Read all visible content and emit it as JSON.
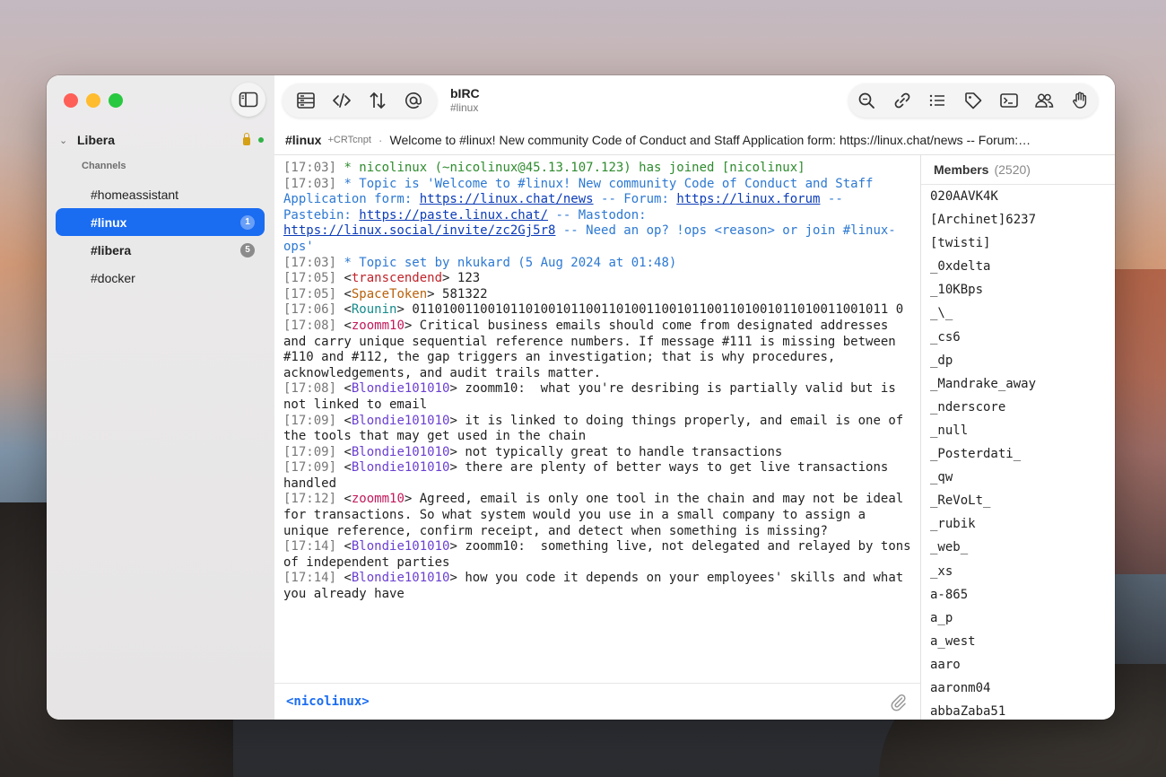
{
  "app": {
    "title": "bIRC",
    "channel": "#linux"
  },
  "sidebar": {
    "network": "Libera",
    "section_label": "Channels",
    "channels": [
      {
        "name": "#homeassistant",
        "badge": ""
      },
      {
        "name": "#linux",
        "badge": "1"
      },
      {
        "name": "#libera",
        "badge": "5"
      },
      {
        "name": "#docker",
        "badge": ""
      }
    ]
  },
  "topic_bar": {
    "channel": "#linux",
    "modes": "+CRTcnpt",
    "separator": "·",
    "text": "Welcome to #linux! New community Code of Conduct and Staff Application form: https://linux.chat/news -- Forum:…"
  },
  "messages": [
    {
      "ts": "[17:03]",
      "type": "join",
      "text": " * nicolinux (~nicolinux@45.13.107.123) has joined [nicolinux]"
    },
    {
      "ts": "[17:03]",
      "type": "topic",
      "pre": " * Topic is 'Welcome to #linux! New community Code of Conduct and Staff Application form: ",
      "link1": "https://linux.chat/news",
      "mid1": " -- Forum: ",
      "link2": "https://linux.forum",
      "mid2": " -- Pastebin: ",
      "link3": "https://paste.linux.chat/",
      "mid3": " -- Mastodon: ",
      "link4": "https://linux.social/invite/zc2Gj5r8",
      "post": " -- Need an op? !ops <reason> or join #linux-ops'"
    },
    {
      "ts": "[17:03]",
      "type": "topic",
      "text": " * Topic set by nkukard (5 Aug 2024 at 01:48)"
    },
    {
      "ts": "[17:05]",
      "type": "msg",
      "nick": "transcendend",
      "color": "red",
      "text": " 123"
    },
    {
      "ts": "[17:05]",
      "type": "msg",
      "nick": "SpaceToken",
      "color": "orange",
      "text": " 581322"
    },
    {
      "ts": "[17:06]",
      "type": "msg",
      "nick": "Rounin",
      "color": "teal",
      "text": " 011010011001011010010110011010011001011001101001011010011001011 0"
    },
    {
      "ts": "[17:08]",
      "type": "msg",
      "nick": "zoomm10",
      "color": "pink",
      "text": " Critical business emails should come from designated addresses and carry unique sequential reference numbers. If message #111 is missing between #110 and #112, the gap triggers an investigation; that is why procedures, acknowledgements, and audit trails matter."
    },
    {
      "ts": "[17:08]",
      "type": "msg",
      "nick": "Blondie101010",
      "color": "purple",
      "text": " zoomm10:  what you're desribing is partially valid but is not linked to email"
    },
    {
      "ts": "[17:09]",
      "type": "msg",
      "nick": "Blondie101010",
      "color": "purple",
      "text": " it is linked to doing things properly, and email is one of the tools that may get used in the chain"
    },
    {
      "ts": "[17:09]",
      "type": "msg",
      "nick": "Blondie101010",
      "color": "purple",
      "text": " not typically great to handle transactions"
    },
    {
      "ts": "[17:09]",
      "type": "msg",
      "nick": "Blondie101010",
      "color": "purple",
      "text": " there are plenty of better ways to get live transactions handled"
    },
    {
      "ts": "[17:12]",
      "type": "msg",
      "nick": "zoomm10",
      "color": "pink",
      "text": " Agreed, email is only one tool in the chain and may not be ideal for transactions. So what system would you use in a small company to assign a unique reference, confirm receipt, and detect when something is missing?"
    },
    {
      "ts": "[17:14]",
      "type": "msg",
      "nick": "Blondie101010",
      "color": "purple",
      "text": " zoomm10:  something live, not delegated and relayed by tons of independent parties"
    },
    {
      "ts": "[17:14]",
      "type": "msg",
      "nick": "Blondie101010",
      "color": "purple",
      "text": " how you code it depends on your employees' skills and what you already have"
    }
  ],
  "input": {
    "nick": "<nicolinux>"
  },
  "members": {
    "title": "Members",
    "count": "(2520)",
    "list": [
      "020AAVK4K",
      "[Archinet]6237",
      "[twisti]",
      "_0xdelta",
      "_10KBps",
      "_\\_",
      "_cs6",
      "_dp",
      "_Mandrake_away",
      "_nderscore",
      "_null",
      "_Posterdati_",
      "_qw",
      "_ReVoLt_",
      "_rubik",
      "_web_",
      "_xs",
      "a-865",
      "a_p",
      "a_west",
      "aaro",
      "aaronm04",
      "abbaZaba51"
    ]
  },
  "colors": {
    "accent": "#1a6cf1",
    "join": "#2e8b2e",
    "topic": "#2d79d2"
  },
  "icons": {
    "toolbar_left": [
      "server-icon",
      "code-icon",
      "updown-arrows-icon",
      "at-icon"
    ],
    "toolbar_right": [
      "search-icon",
      "link-icon",
      "list-icon",
      "tag-icon",
      "terminal-icon",
      "people-icon",
      "hand-icon"
    ]
  }
}
